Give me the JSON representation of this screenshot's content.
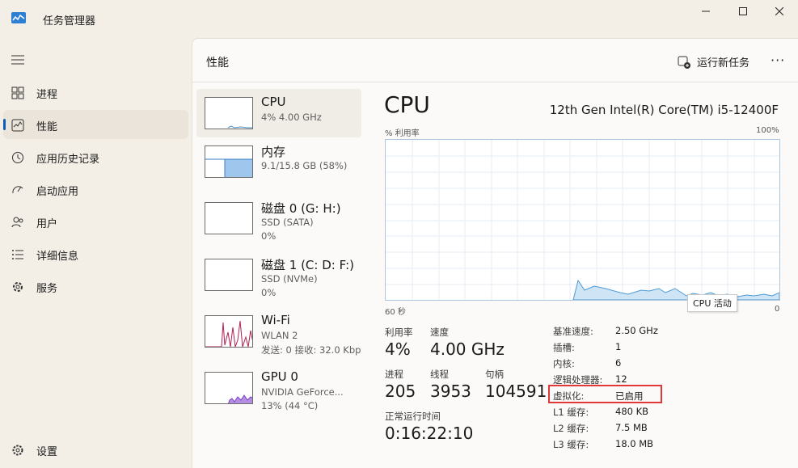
{
  "app": {
    "title": "任务管理器"
  },
  "nav": {
    "items": [
      {
        "label": "进程",
        "icon": "processes-icon"
      },
      {
        "label": "性能",
        "icon": "performance-icon"
      },
      {
        "label": "应用历史记录",
        "icon": "history-icon"
      },
      {
        "label": "启动应用",
        "icon": "startup-icon"
      },
      {
        "label": "用户",
        "icon": "users-icon"
      },
      {
        "label": "详细信息",
        "icon": "details-icon"
      },
      {
        "label": "服务",
        "icon": "services-icon"
      }
    ],
    "settings": "设置"
  },
  "header": {
    "title": "性能",
    "run_task": "运行新任务"
  },
  "devices": [
    {
      "name": "CPU",
      "sub1": "4% 4.00 GHz",
      "sub2": ""
    },
    {
      "name": "内存",
      "sub1": "9.1/15.8 GB (58%)",
      "sub2": ""
    },
    {
      "name": "磁盘 0 (G: H:)",
      "sub1": "SSD (SATA)",
      "sub2": "0%"
    },
    {
      "name": "磁盘 1 (C: D: F:)",
      "sub1": "SSD (NVMe)",
      "sub2": "0%"
    },
    {
      "name": "Wi-Fi",
      "sub1": "WLAN 2",
      "sub2": "发送: 0 接收: 32.0 Kbp"
    },
    {
      "name": "GPU 0",
      "sub1": "NVIDIA GeForce...",
      "sub2": "13% (44 °C)"
    }
  ],
  "cpu": {
    "title": "CPU",
    "model": "12th Gen Intel(R) Core(TM) i5-12400F",
    "graph_label_left": "% 利用率",
    "graph_label_right": "100%",
    "time_left": "60 秒",
    "time_right": "0",
    "tooltip": "CPU 活动",
    "stats": {
      "util_label": "利用率",
      "util": "4%",
      "speed_label": "速度",
      "speed": "4.00 GHz",
      "proc_label": "进程",
      "proc": "205",
      "thread_label": "线程",
      "thread": "3953",
      "handle_label": "句柄",
      "handle": "104591",
      "uptime_label": "正常运行时间",
      "uptime": "0:16:22:10"
    },
    "specs": [
      {
        "k": "基准速度:",
        "v": "2.50 GHz"
      },
      {
        "k": "插槽:",
        "v": "1"
      },
      {
        "k": "内核:",
        "v": "6"
      },
      {
        "k": "逻辑处理器:",
        "v": "12"
      },
      {
        "k": "虚拟化:",
        "v": "已启用"
      },
      {
        "k": "L1 缓存:",
        "v": "480 KB"
      },
      {
        "k": "L2 缓存:",
        "v": "7.5 MB"
      },
      {
        "k": "L3 缓存:",
        "v": "18.0 MB"
      }
    ]
  }
}
